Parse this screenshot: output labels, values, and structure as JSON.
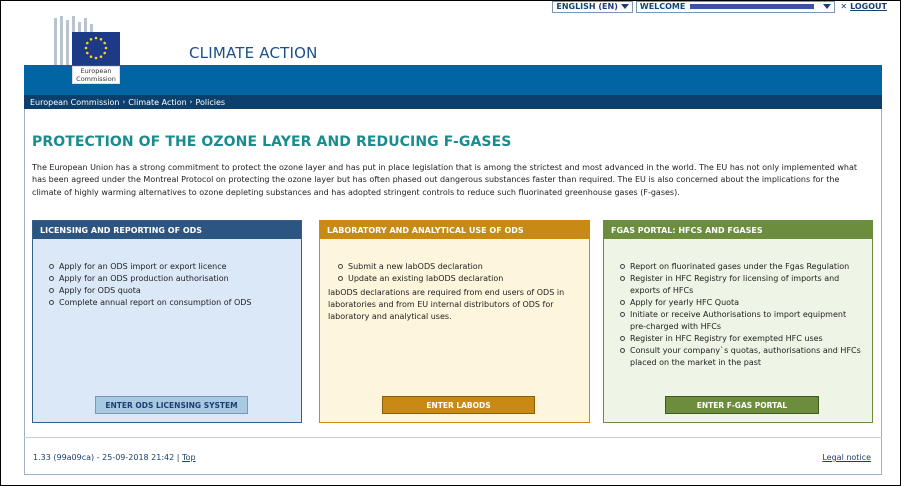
{
  "utility_bar": {
    "language": "ENGLISH (EN)",
    "welcome_label": "WELCOME",
    "logout": "LOGOUT"
  },
  "header": {
    "logo_text_line1": "European",
    "logo_text_line2": "Commission",
    "site_title": "CLIMATE ACTION",
    "brand_color": "#0065a2"
  },
  "breadcrumb": [
    "European Commission",
    "Climate Action",
    "Policies"
  ],
  "main": {
    "title": "PROTECTION OF THE OZONE LAYER AND REDUCING F-GASES",
    "intro": "The European Union has a strong commitment to protect the ozone layer and has put in place legislation that is among the strictest and most advanced in the world. The EU has not only implemented what has been agreed under the Montreal Protocol on protecting the ozone layer but has often phased out dangerous substances faster than required. The EU is also concerned about the implications for the climate of highly warming alternatives to ozone depleting substances and has adopted stringent controls to reduce such fluorinated greenhouse gases (F-gases)."
  },
  "cards": [
    {
      "title": "LICENSING AND REPORTING OF ODS",
      "items": [
        "Apply for an ODS import or export licence",
        "Apply for an ODS production authorisation",
        "Apply for ODS quota",
        "Complete annual report on consumption of ODS"
      ],
      "button": "ENTER ODS LICENSING SYSTEM"
    },
    {
      "title": "LABORATORY AND ANALYTICAL USE OF ODS",
      "items": [
        "Submit a new labODS declaration",
        "Update an existing labODS declaration"
      ],
      "note": "labODS declarations are required from end users of ODS in laboratories and from EU internal distributors of ODS for laboratory and analytical uses.",
      "button": "ENTER LABODS"
    },
    {
      "title": "FGAS PORTAL: HFCS AND FGASES",
      "items": [
        "Report on fluorinated gases under the Fgas Regulation",
        "Register in HFC Registry for licensing of imports and exports of HFCs",
        "Apply for yearly HFC Quota",
        "Initiate or receive Authorisations to import equipment pre-charged with HFCs",
        "Register in HFC Registry for exempted HFC uses",
        "Consult your company`s quotas, authorisations and HFCs placed on the market in the past"
      ],
      "button": "ENTER F-GAS PORTAL"
    }
  ],
  "footer": {
    "version": "1.33 (99a09ca) - 25-09-2018 21:42 |",
    "top_link": "Top",
    "legal": "Legal notice"
  }
}
